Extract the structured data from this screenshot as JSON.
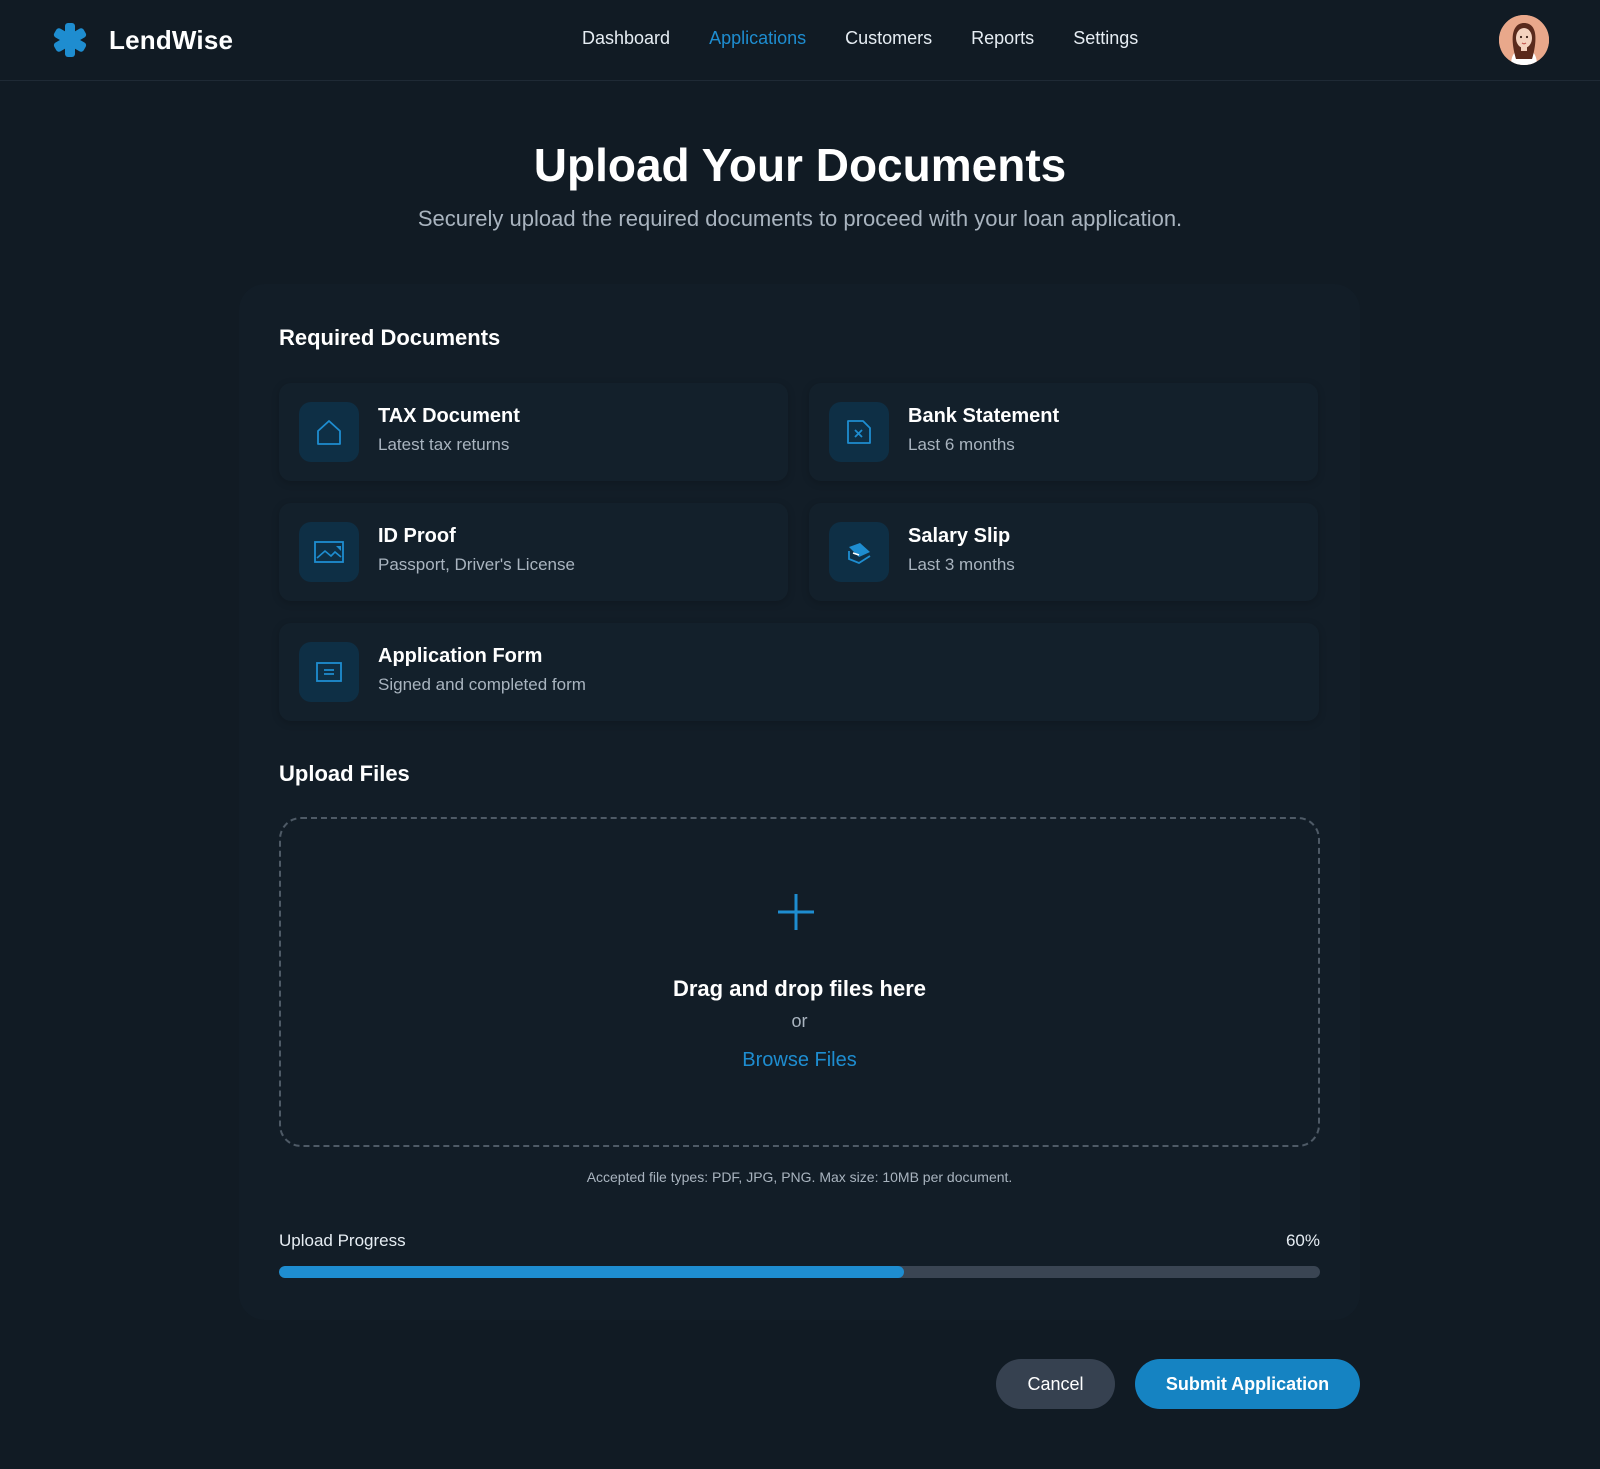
{
  "app": {
    "name": "LendWise",
    "logo_icon": "asterisk-icon"
  },
  "nav": {
    "items": [
      {
        "label": "Dashboard",
        "active": false
      },
      {
        "label": "Applications",
        "active": true
      },
      {
        "label": "Customers",
        "active": false
      },
      {
        "label": "Reports",
        "active": false
      },
      {
        "label": "Settings",
        "active": false
      }
    ]
  },
  "page": {
    "title": "Upload Your Documents",
    "subtitle": "Securely upload the required documents to proceed with your loan application."
  },
  "required": {
    "title": "Required Documents",
    "documents": [
      {
        "name": "TAX Document",
        "description": "Latest tax returns",
        "icon": "house-icon"
      },
      {
        "name": "Bank Statement",
        "description": "Last 6 months",
        "icon": "statement-icon"
      },
      {
        "name": "ID Proof",
        "description": "Passport, Driver's License",
        "icon": "id-card-icon"
      },
      {
        "name": "Salary Slip",
        "description": "Last 3 months",
        "icon": "money-icon"
      },
      {
        "name": "Application Form",
        "description": "Signed and completed form",
        "icon": "form-icon"
      }
    ]
  },
  "upload": {
    "title": "Upload Files",
    "drop_text": "Drag and drop files here",
    "or_text": "or",
    "browse_label": "Browse Files",
    "accepted_text": "Accepted file types: PDF, JPG, PNG. Max size: 10MB per document.",
    "progress_label": "Upload Progress",
    "progress_value": "60%",
    "progress_fraction": 0.6
  },
  "actions": {
    "cancel_label": "Cancel",
    "submit_label": "Submit Application"
  },
  "colors": {
    "background": "#111b24",
    "card": "#121d27",
    "accent": "#1e8dd0",
    "button_primary": "#1583c2",
    "button_secondary": "#364150"
  }
}
